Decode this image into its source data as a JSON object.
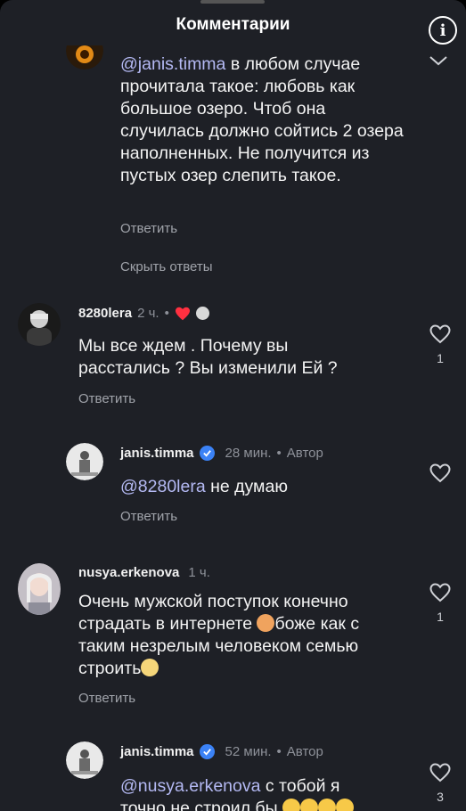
{
  "header": {
    "title": "Комментарии"
  },
  "comments": [
    {
      "reply_text_mention": "@janis.timma",
      "reply_text_body": " в любом случае прочитала такое: любовь как большое озеро. Чтоб она случилась должно сойтись 2 озера наполненных. Не получится из пустых озер слепить такое.",
      "reply_label": "Ответить",
      "hide_replies_label": "Скрыть ответы"
    },
    {
      "username": "8280lera",
      "time": "2 ч.",
      "dot": "•",
      "text": "Мы все ждем . Почему вы расстались ? Вы изменили Ей ?",
      "reply_label": "Ответить",
      "likes": "1"
    },
    {
      "username": "janis.timma",
      "time": "28 мин.",
      "dot": "•",
      "author_label": "Автор",
      "mention": "@8280lera",
      "text": " не думаю",
      "reply_label": "Ответить"
    },
    {
      "username": "nusya.erkenova",
      "time": "1 ч.",
      "line1": "Очень мужской поступок конечно",
      "line2a": "страдать в интернете ",
      "line2b": "боже как с",
      "line3": "таким незрелым человеком семью",
      "line4": "строить",
      "reply_label": "Ответить",
      "likes": "1"
    },
    {
      "username": "janis.timma",
      "time": "52 мин.",
      "dot": "•",
      "author_label": "Автор",
      "mention": "@nusya.erkenova",
      "text": " с тобой я",
      "line2": "точно не строил бы",
      "likes": "3"
    }
  ],
  "colors": {
    "background": "#1e2026",
    "mention": "#b4b9f3",
    "secondary_text": "#a0a3aa",
    "verified": "#3b82f6",
    "heart": "#ff3040"
  }
}
